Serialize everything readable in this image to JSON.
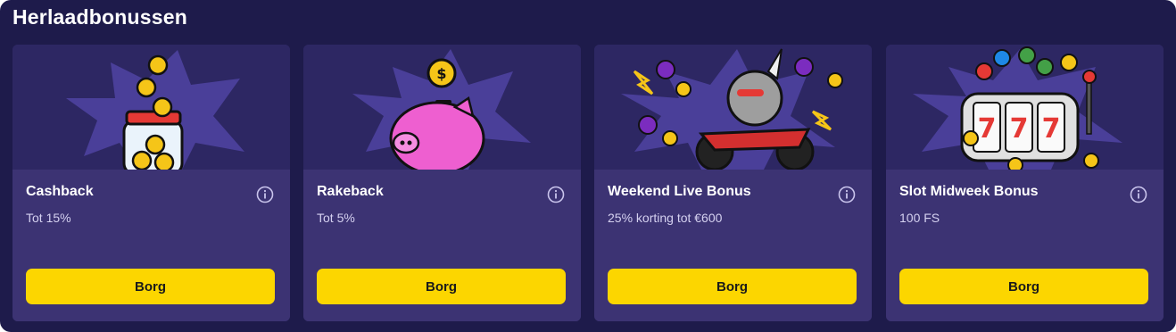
{
  "section": {
    "title": "Herlaadbonussen"
  },
  "colors": {
    "panel_bg": "#1e1b4b",
    "card_bg": "#3c3373",
    "art_bg": "#2d2763",
    "button_bg": "#fcd600",
    "button_text": "#1b1b1b"
  },
  "cards": [
    {
      "title": "Cashback",
      "subtitle": "Tot 15%",
      "button": "Borg",
      "art_icon": "coin-jar-icon"
    },
    {
      "title": "Rakeback",
      "subtitle": "Tot 5%",
      "button": "Borg",
      "art_icon": "piggy-bank-icon"
    },
    {
      "title": "Weekend Live Bonus",
      "subtitle": "25% korting tot €600",
      "button": "Borg",
      "art_icon": "rhino-motorbike-icon"
    },
    {
      "title": "Slot Midweek Bonus",
      "subtitle": "100 FS",
      "button": "Borg",
      "art_icon": "slot-machine-777-icon"
    }
  ]
}
